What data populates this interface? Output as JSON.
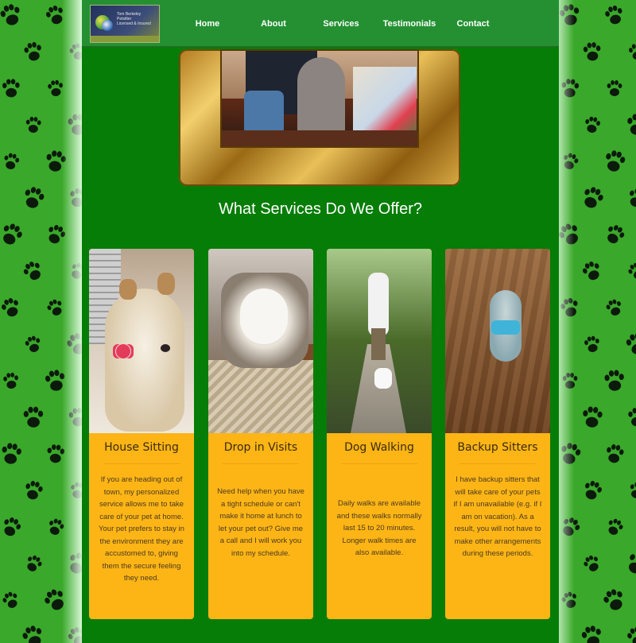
{
  "logo": {
    "line1": "Tom Berkeley",
    "line2": "Petsitter",
    "line3": "Licensed & Insured"
  },
  "nav": {
    "items": [
      "Home",
      "About",
      "Services",
      "Testimonials",
      "Contact"
    ]
  },
  "section": {
    "title": "What Services Do We Offer?"
  },
  "services": [
    {
      "title": "House Sitting",
      "text": "If you are heading out of town, my personalized service allows me to take care of your pet at home. Your pet prefers to stay in the environment they are accustomed to, giving them the secure feeling they need."
    },
    {
      "title": "Drop in Visits",
      "text": "Need help when you have a tight schedule or can't make it home at lunch to let your pet out? Give me a call and I will work you into my schedule."
    },
    {
      "title": "Dog Walking",
      "text": "Daily walks are available and these walks normally last 15 to 20 minutes. Longer walk times are also available."
    },
    {
      "title": "Backup Sitters",
      "text": "I have backup sitters that will take care of your pets if I am unavailable (e.g. if I am on vacation). As a result, you will not have to make other arrangements during these periods."
    }
  ],
  "colors": {
    "page_bg": "#067d06",
    "nav_bg": "#249032",
    "card_bg": "#fdb516",
    "paw_bg": "#3aa82a"
  }
}
